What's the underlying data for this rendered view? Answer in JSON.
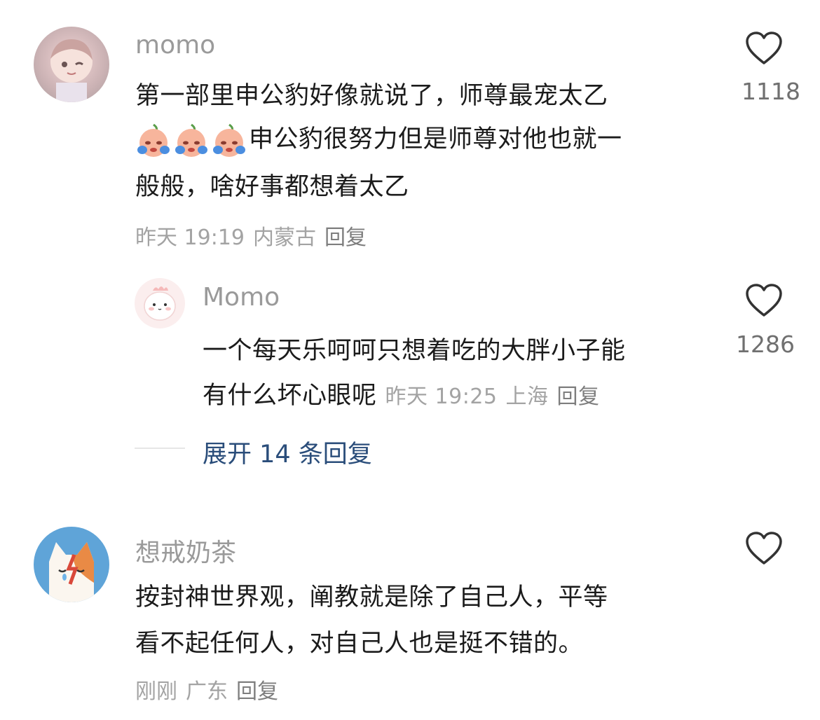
{
  "comments": [
    {
      "username": "momo",
      "line1": "第一部里申公豹好像就说了，师尊最宠太乙",
      "line2_text": "申公豹很努力但是师尊对他也就一",
      "line3": "般般，啥好事都想着太乙",
      "emoji_name": "crying-face-emoji",
      "time": "昨天 19:19",
      "location": "内蒙古",
      "reply_label": "回复",
      "likes": "1118",
      "replies": [
        {
          "username": "Momo",
          "line1": "一个每天乐呵呵只想着吃的大胖小子能",
          "line2": "有什么坏心眼呢",
          "time": "昨天 19:25",
          "location": "上海",
          "reply_label": "回复",
          "likes": "1286"
        }
      ],
      "expand_label": "展开 14 条回复"
    },
    {
      "username": "想戒奶茶",
      "line1": "按封神世界观，阐教就是除了自己人，平等",
      "line2": "看不起任何人，对自己人也是挺不错的。",
      "time": "刚刚",
      "location": "广东",
      "reply_label": "回复"
    }
  ],
  "colors": {
    "username": "#9a9a9a",
    "body": "#1b1b1b",
    "meta": "#a3a3a3",
    "expand": "#2a4d7a"
  }
}
